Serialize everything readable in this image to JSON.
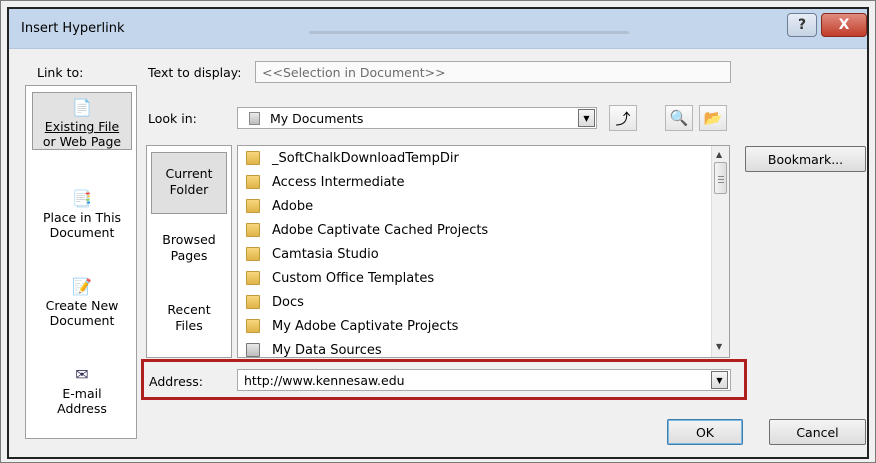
{
  "window": {
    "title": "Insert Hyperlink",
    "help_glyph": "?",
    "close_glyph": "X"
  },
  "link_to": {
    "label": "Link to:",
    "items": [
      {
        "line1": "Existing File",
        "line2": "or Web Page",
        "icon": "document-globe-icon",
        "glyph": "📄",
        "active": true
      },
      {
        "line1": "Place in This",
        "line2": "Document",
        "icon": "document-place-icon",
        "glyph": "📑",
        "active": false
      },
      {
        "line1": "Create New",
        "line2": "Document",
        "icon": "new-document-icon",
        "glyph": "📝",
        "active": false
      },
      {
        "line1": "E-mail",
        "line2": "Address",
        "icon": "email-icon",
        "glyph": "✉",
        "active": false
      }
    ]
  },
  "text_to_display": {
    "label": "Text to display:",
    "value": "<<Selection in Document>>"
  },
  "look_in": {
    "label": "Look in:",
    "value": "My Documents",
    "up_folder_glyph": "⤴",
    "browse_web_glyph": "🔍",
    "browse_file_glyph": "📂"
  },
  "nav": {
    "items": [
      {
        "line1": "Current",
        "line2": "Folder",
        "active": true
      },
      {
        "line1": "Browsed",
        "line2": "Pages",
        "active": false
      },
      {
        "line1": "Recent",
        "line2": "Files",
        "active": false
      }
    ]
  },
  "files": [
    {
      "name": "_SoftChalkDownloadTempDir",
      "type": "folder"
    },
    {
      "name": "Access Intermediate",
      "type": "folder"
    },
    {
      "name": "Adobe",
      "type": "folder"
    },
    {
      "name": "Adobe Captivate Cached Projects",
      "type": "folder"
    },
    {
      "name": "Camtasia Studio",
      "type": "folder"
    },
    {
      "name": "Custom Office Templates",
      "type": "folder"
    },
    {
      "name": "Docs",
      "type": "folder"
    },
    {
      "name": "My Adobe Captivate Projects",
      "type": "folder"
    },
    {
      "name": "My Data Sources",
      "type": "datasource"
    }
  ],
  "address": {
    "label": "Address:",
    "value": "http://www.kennesaw.edu"
  },
  "buttons": {
    "bookmark": "Bookmark...",
    "ok": "OK",
    "cancel": "Cancel"
  },
  "colors": {
    "highlight_border": "#b01e1e",
    "titlebar": "#c3d6ec",
    "folder": "#e0b44a"
  }
}
